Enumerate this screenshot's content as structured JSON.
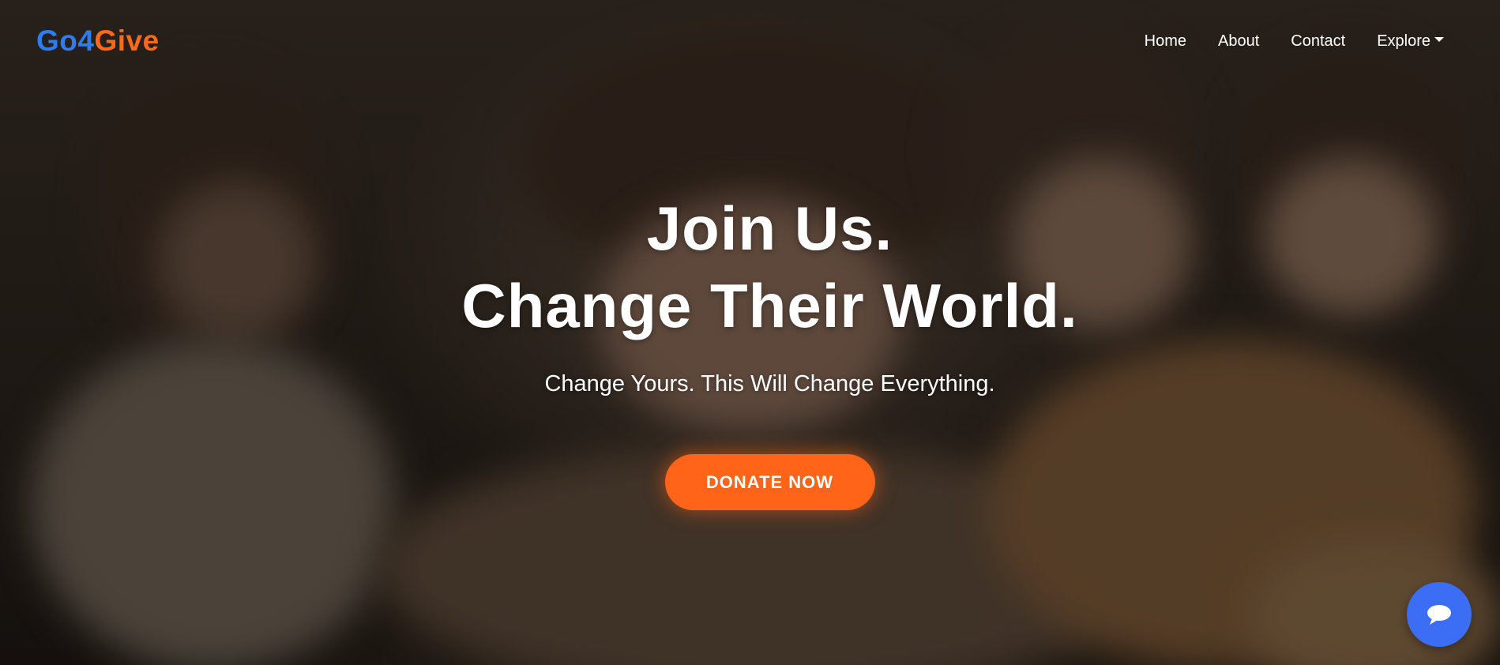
{
  "brand": {
    "part1": "Go4",
    "part2": "Give",
    "color1": "#2f7bf0",
    "color2": "#ff6a1a"
  },
  "nav": {
    "items": [
      {
        "label": "Home"
      },
      {
        "label": "About"
      },
      {
        "label": "Contact"
      },
      {
        "label": "Explore",
        "has_dropdown": true
      }
    ]
  },
  "hero": {
    "headline_line1": "Join Us.",
    "headline_line2": "Change Their World.",
    "subheadline": "Change Yours. This Will Change Everything.",
    "cta_label": "DONATE NOW",
    "cta_color": "#ff6418"
  },
  "chat": {
    "icon": "chat-bubble-icon",
    "color": "#3b6ef5"
  }
}
